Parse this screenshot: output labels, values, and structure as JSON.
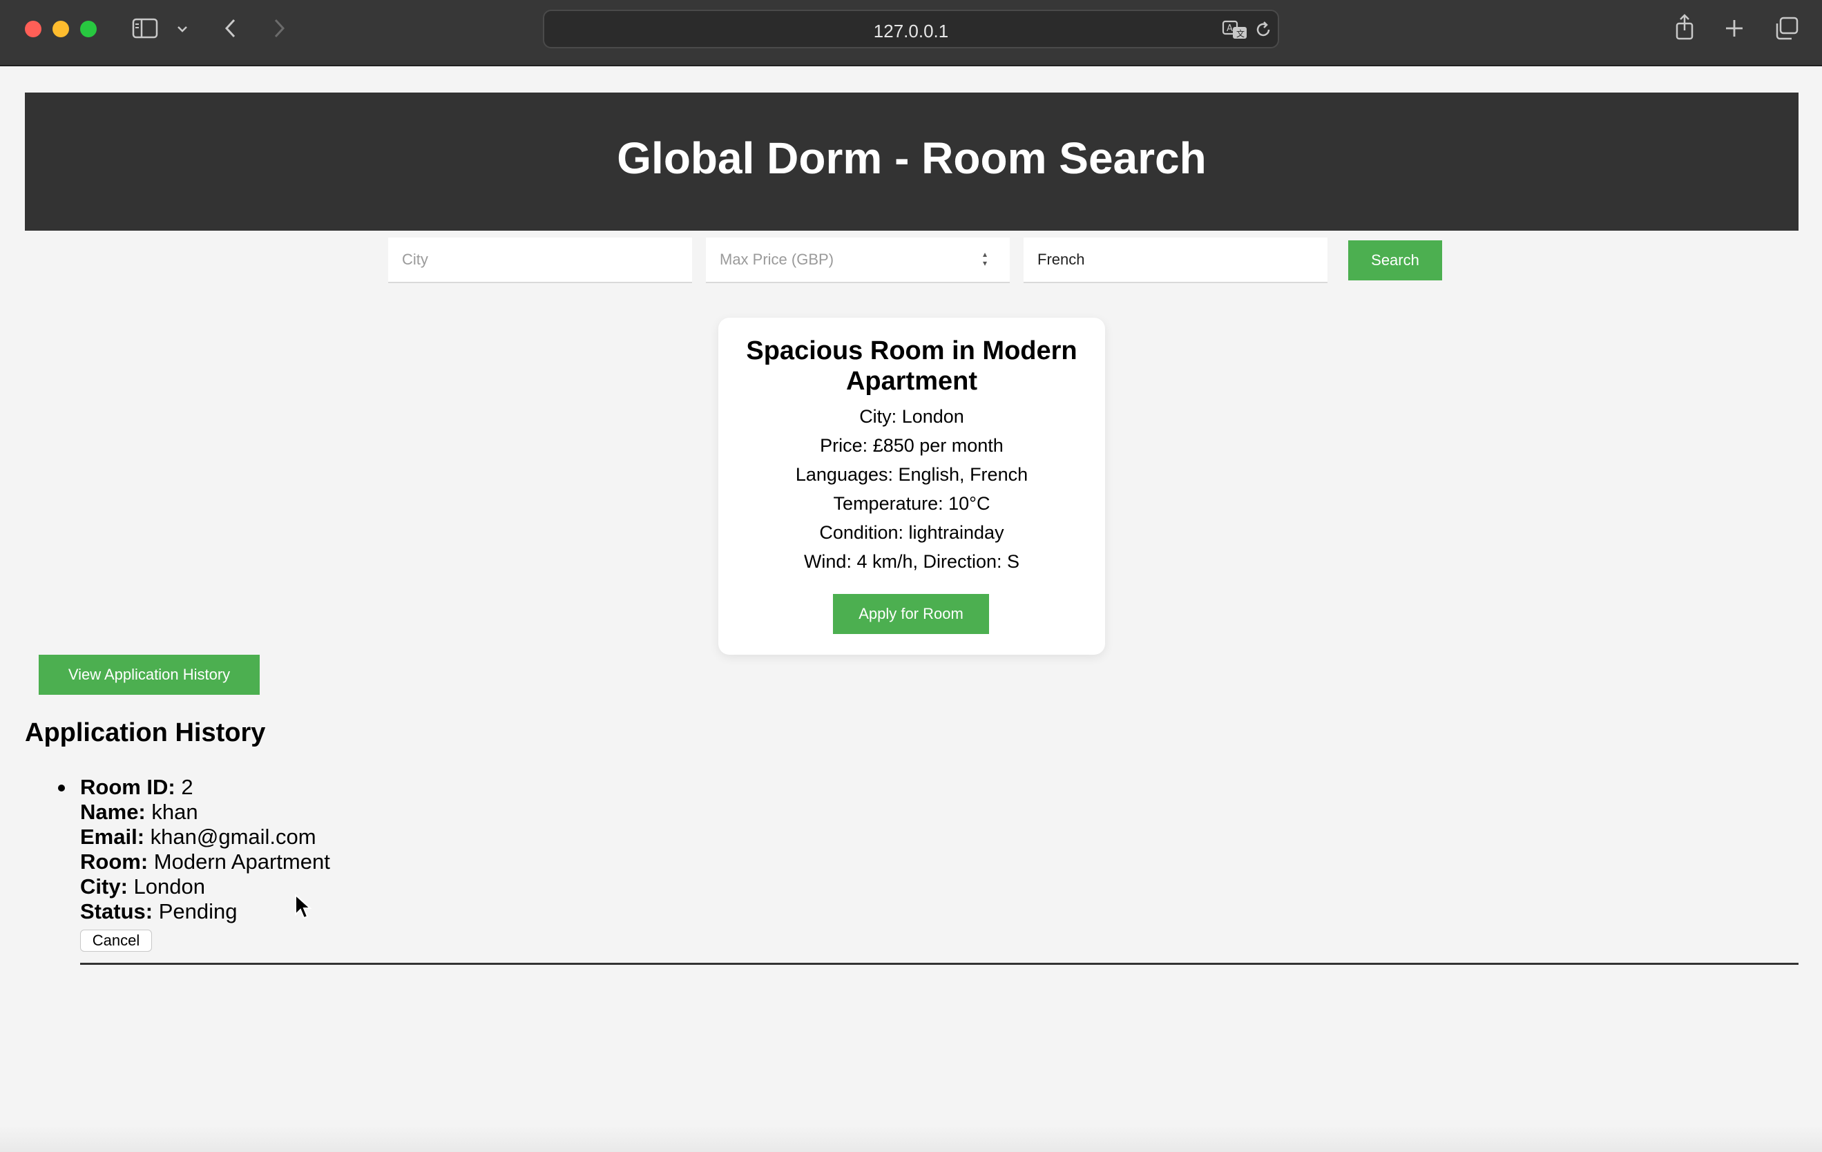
{
  "browser": {
    "url": "127.0.0.1",
    "icons": [
      "sidebar-icon",
      "chevron-down-icon",
      "back-icon",
      "forward-icon",
      "translate-icon",
      "reload-icon",
      "share-icon",
      "new-tab-icon",
      "tabs-overview-icon"
    ]
  },
  "header": {
    "title": "Global Dorm - Room Search"
  },
  "search": {
    "city_placeholder": "City",
    "city_value": "",
    "price_placeholder": "Max Price (GBP)",
    "price_value": "",
    "language_value": "French",
    "search_label": "Search"
  },
  "room": {
    "title": "Spacious Room in Modern Apartment",
    "city": "City: London",
    "price": "Price: £850 per month",
    "languages": "Languages: English, French",
    "temperature": "Temperature: 10°C",
    "condition": "Condition: lightrainday",
    "wind": "Wind: 4 km/h, Direction: S",
    "apply_label": "Apply for Room"
  },
  "history_button_label": "View Application History",
  "history": {
    "title": "Application History",
    "entries": [
      {
        "room_id_label": "Room ID:",
        "room_id": "2",
        "name_label": "Name:",
        "name": "khan",
        "email_label": "Email:",
        "email": "khan@gmail.com",
        "room_label": "Room:",
        "room": "Modern Apartment",
        "city_label": "City:",
        "city": "London",
        "status_label": "Status:",
        "status": "Pending",
        "cancel_label": "Cancel"
      }
    ]
  },
  "colors": {
    "accent": "#4caf50",
    "banner": "#333333",
    "background": "#f4f4f4"
  }
}
